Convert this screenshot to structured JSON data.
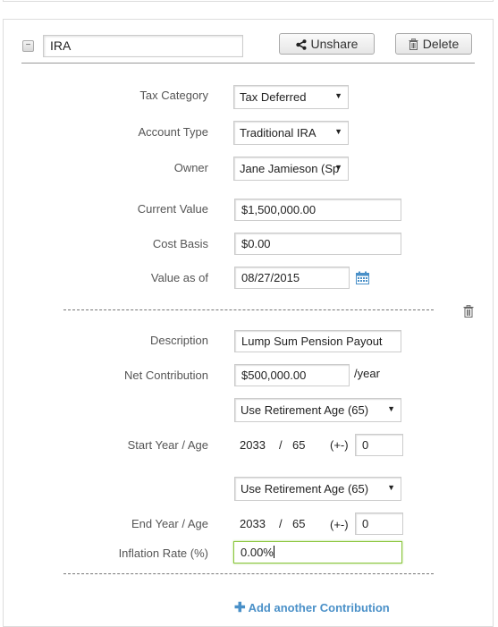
{
  "account": {
    "collapse_symbol": "−",
    "name": "IRA",
    "unshare_label": "Unshare",
    "delete_label": "Delete",
    "icons": {
      "collapse": "minus-icon",
      "unshare": "share-icon",
      "delete": "trash-icon"
    }
  },
  "fields": {
    "tax_category": {
      "label": "Tax Category",
      "value": "Tax Deferred"
    },
    "account_type": {
      "label": "Account Type",
      "value": "Traditional IRA"
    },
    "owner": {
      "label": "Owner",
      "value": "Jane Jamieson (Sp"
    },
    "current_value": {
      "label": "Current Value",
      "value": "$1,500,000.00"
    },
    "cost_basis": {
      "label": "Cost Basis",
      "value": "$0.00"
    },
    "value_as_of": {
      "label": "Value as of",
      "value": "08/27/2015",
      "icon": "calendar-icon"
    }
  },
  "contribution": {
    "remove_icon": "trash-icon",
    "description": {
      "label": "Description",
      "value": "Lump Sum Pension Payout"
    },
    "net_contribution": {
      "label": "Net Contribution",
      "value": "$500,000.00",
      "suffix": "/year"
    },
    "start": {
      "select_value": "Use Retirement Age (65)",
      "label": "Start Year / Age",
      "year": "2033",
      "separator": "/",
      "age": "65",
      "offset_label": "(+-)",
      "offset_value": "0"
    },
    "end": {
      "select_value": "Use Retirement Age (65)",
      "label": "End Year / Age",
      "year": "2033",
      "separator": "/",
      "age": "65",
      "offset_label": "(+-)",
      "offset_value": "0"
    },
    "inflation": {
      "label": "Inflation Rate (%)",
      "value": "0.00%"
    }
  },
  "add_contribution_label": "Add another Contribution",
  "select_arrow": "▼",
  "colors": {
    "link": "#4a90c8",
    "focus_border": "#8cc63f",
    "calendar": "#4a90c8"
  }
}
